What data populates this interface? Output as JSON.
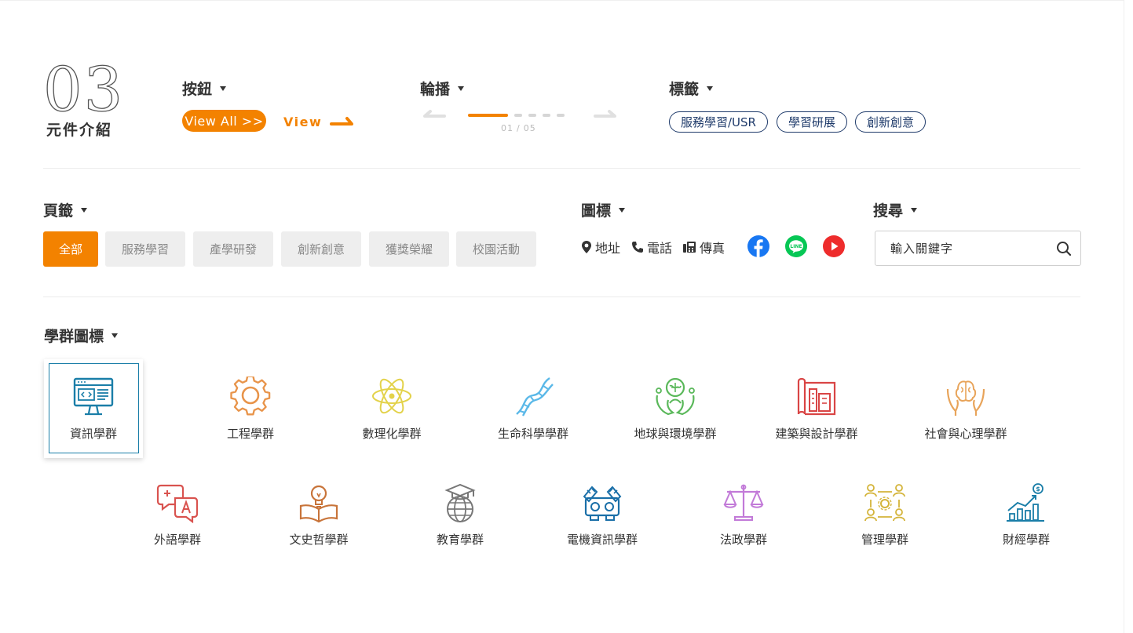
{
  "section": {
    "number": "03",
    "title": "元件介紹"
  },
  "buttons": {
    "heading": "按鈕",
    "view_all": "View All >>",
    "view": "View"
  },
  "carousel": {
    "heading": "輪播",
    "current": "01",
    "separator": "/",
    "total": "05"
  },
  "tags": {
    "heading": "標籤",
    "items": [
      "服務學習/USR",
      "學習研展",
      "創新創意"
    ]
  },
  "tabs": {
    "heading": "頁籤",
    "items": [
      "全部",
      "服務學習",
      "產學研發",
      "創新創意",
      "獲獎榮耀",
      "校園活動"
    ],
    "active": 0
  },
  "icons": {
    "heading": "圖標",
    "contacts": [
      {
        "icon": "map-pin-icon",
        "label": "地址"
      },
      {
        "icon": "phone-icon",
        "label": "電話"
      },
      {
        "icon": "fax-icon",
        "label": "傳真"
      }
    ],
    "social": [
      "facebook-icon",
      "line-icon",
      "youtube-icon"
    ]
  },
  "search": {
    "heading": "搜尋",
    "placeholder": "輸入關鍵字"
  },
  "fields": {
    "heading": "學群圖標",
    "row1": [
      "資訊學群",
      "工程學群",
      "數理化學群",
      "生命科學學群",
      "地球與環境學群",
      "建築與設計學群",
      "社會與心理學群"
    ],
    "row2": [
      "外語學群",
      "文史哲學群",
      "教育學群",
      "電機資訊學群",
      "法政學群",
      "管理學群",
      "財經學群"
    ]
  },
  "colors": {
    "accent": "#f38200",
    "navy": "#1e3a6a",
    "facebook": "#1877f2",
    "line": "#06c755",
    "youtube": "#ff0000"
  }
}
